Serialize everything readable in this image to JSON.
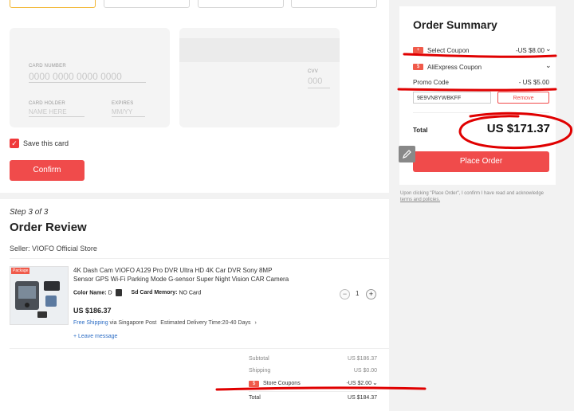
{
  "payment": {
    "card_number_label": "CARD NUMBER",
    "card_number_placeholder": "0000 0000 0000 0000",
    "card_holder_label": "CARD HOLDER",
    "card_holder_placeholder": "NAME HERE",
    "expires_label": "EXPIRES",
    "expires_placeholder": "MM/YY",
    "cvv_label": "CVV",
    "cvv_placeholder": "000",
    "save_card_label": "Save this card",
    "save_checked": true,
    "confirm_label": "Confirm"
  },
  "review": {
    "step_label": "Step 3 of 3",
    "title": "Order Review",
    "seller": "Seller: VIOFO Official Store",
    "product": {
      "package_badge": "Package",
      "title": "4K Dash Cam VIOFO A129 Pro DVR Ultra HD 4K Car DVR Sony 8MP Sensor GPS Wi-Fi Parking Mode G-sensor Super Night Vision CAR Camera",
      "color_label": "Color Name:",
      "color_value": "D",
      "memory_label": "Sd Card Memory:",
      "memory_value": "NO Card",
      "price": "US $186.37",
      "quantity": "1",
      "free_shipping": "Free Shipping",
      "shipping_via": "via Singapore Post",
      "delivery": "Estimated Delivery Time:20-40 Days",
      "leave_message": "+ Leave message"
    },
    "totals": {
      "subtotal_label": "Subtotal",
      "subtotal_value": "US $186.37",
      "shipping_label": "Shipping",
      "shipping_value": "US $0.00",
      "store_coupons_label": "Store Coupons",
      "store_coupons_value": "-US $2.00",
      "total_label": "Total",
      "total_value": "US $184.37"
    }
  },
  "summary": {
    "title": "Order Summary",
    "select_coupon_label": "Select Coupon",
    "select_coupon_value": "-US $8.00",
    "aliexpress_coupon_label": "AliExpress Coupon",
    "promo_code_label": "Promo Code",
    "promo_code_value": "- US $5.00",
    "promo_code_input": "9E9VN8YWBKFF",
    "remove_label": "Remove",
    "total_label": "Total",
    "total_value": "US $171.37",
    "place_order_label": "Place Order",
    "disclaimer": "Upon clicking \"Place Order\", I confirm I have read and acknowledge",
    "terms_link": "terms and policies."
  },
  "colors": {
    "accent_red": "#f04b4b",
    "annotation_red": "#e00000",
    "link_blue": "#2b6cc4"
  },
  "icons": [
    "check-icon",
    "coupon-icon",
    "chevron-down-icon",
    "chevron-right-icon",
    "minus-icon",
    "plus-icon",
    "edit-icon"
  ]
}
